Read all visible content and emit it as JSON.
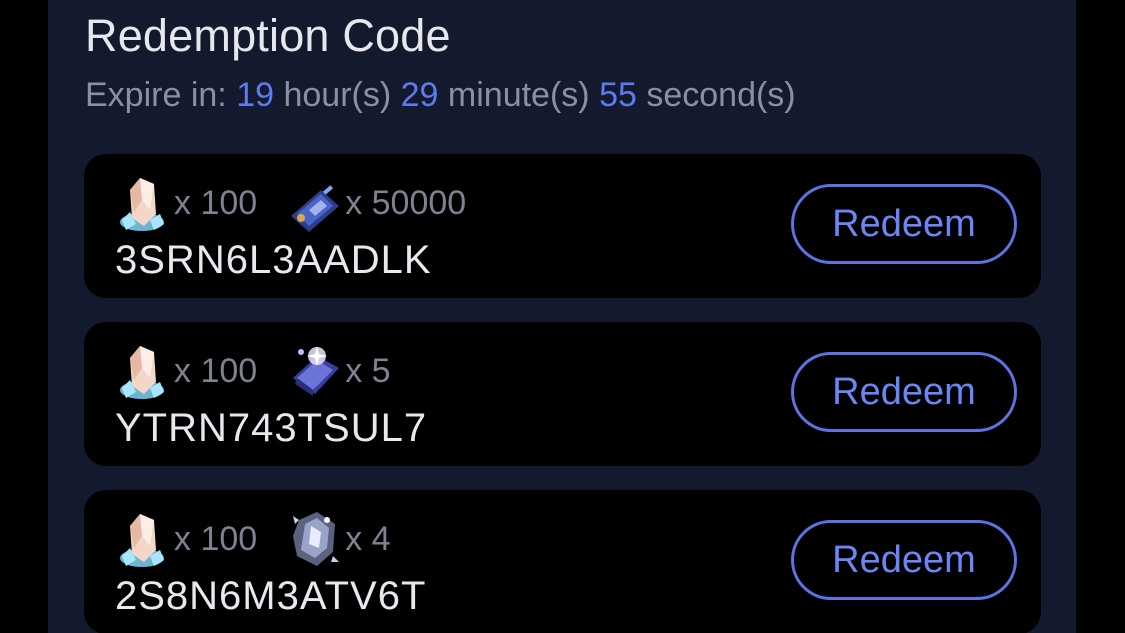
{
  "header": {
    "title": "Redemption Code",
    "expire_label": "Expire in:",
    "hours": "19",
    "hours_unit": "hour(s)",
    "minutes": "29",
    "minutes_unit": "minute(s)",
    "seconds": "55",
    "seconds_unit": "second(s)"
  },
  "codes": [
    {
      "code": "3SRN6L3AADLK",
      "rewards": [
        {
          "icon": "crystal-icon",
          "qty": "x 100"
        },
        {
          "icon": "ticket-icon",
          "qty": "x 50000"
        }
      ],
      "button_label": "Redeem"
    },
    {
      "code": "YTRN743TSUL7",
      "rewards": [
        {
          "icon": "crystal-icon",
          "qty": "x 100"
        },
        {
          "icon": "book-icon",
          "qty": "x 5"
        }
      ],
      "button_label": "Redeem"
    },
    {
      "code": "2S8N6M3ATV6T",
      "rewards": [
        {
          "icon": "crystal-icon",
          "qty": "x 100"
        },
        {
          "icon": "ore-icon",
          "qty": "x 4"
        }
      ],
      "button_label": "Redeem"
    }
  ],
  "colors": {
    "panel_bg": "#141a2e",
    "card_bg": "#000000",
    "accent": "#5e7af0",
    "muted_text": "#8b90a0"
  }
}
